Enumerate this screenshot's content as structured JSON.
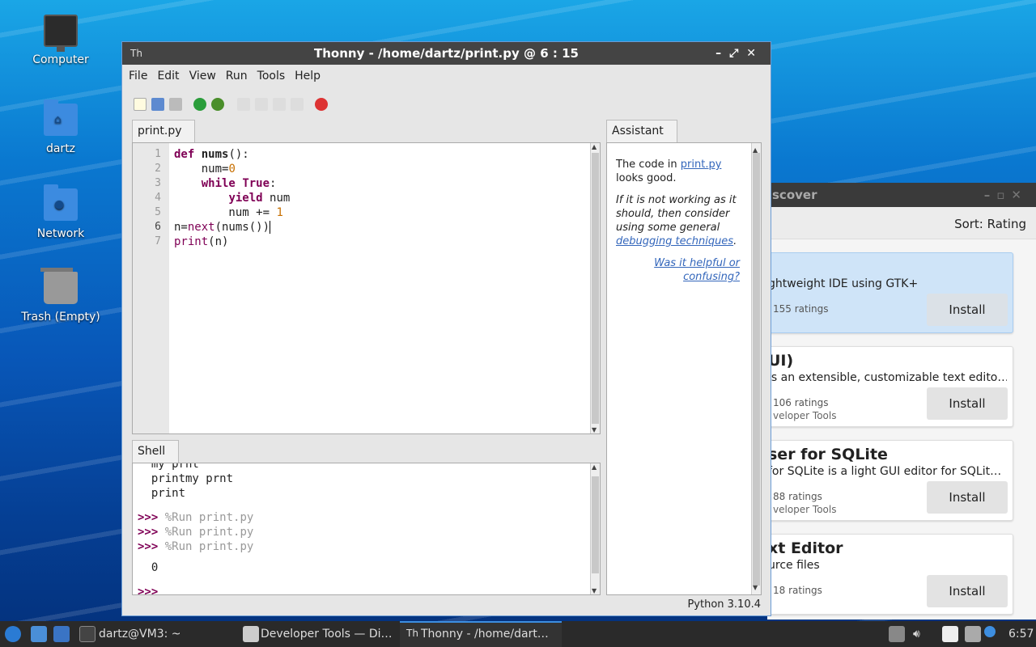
{
  "desktop": {
    "icons": [
      {
        "label": "Computer"
      },
      {
        "label": "dartz"
      },
      {
        "label": "Network"
      },
      {
        "label": "Trash (Empty)"
      }
    ]
  },
  "discover": {
    "title": "scover",
    "sort_label": "Sort: Rating",
    "cards": [
      {
        "title": "",
        "desc": "ghtweight IDE using GTK+",
        "ratings": "155 ratings",
        "category": "",
        "install": "Install"
      },
      {
        "title": "UI)",
        "desc": "is an extensible, customizable text edito…",
        "ratings": "106 ratings",
        "category": "veloper Tools",
        "install": "Install"
      },
      {
        "title": "ser for SQLite",
        "desc": "for SQLite is a light GUI editor for SQLit…",
        "ratings": "88 ratings",
        "category": "veloper Tools",
        "install": "Install"
      },
      {
        "title": "xt Editor",
        "desc": "urce files",
        "ratings": "18 ratings",
        "category": "",
        "install": "Install"
      }
    ]
  },
  "thonny": {
    "title": "Thonny  -  /home/dartz/print.py  @  6 : 15",
    "logo": "Th",
    "menu": [
      "File",
      "Edit",
      "View",
      "Run",
      "Tools",
      "Help"
    ],
    "editor_tab": "print.py",
    "shell_tab": "Shell",
    "assistant_tab": "Assistant",
    "line_numbers": [
      "1",
      "2",
      "3",
      "4",
      "5",
      "6",
      "7"
    ],
    "shell": {
      "line1": "my prnt",
      "line2": "printmy prnt",
      "line3": "print",
      "prompt": ">>>",
      "cmd": "%Run print.py",
      "output": "0"
    },
    "assistant": {
      "p1a": "The code in ",
      "p1link": "print.py",
      "p1b": " looks good.",
      "p2a": "If it is not working as it should, then consider using some general ",
      "p2link": "debugging techniques",
      "p2b": ".",
      "feedback": "Was it helpful or confusing?"
    },
    "status": "Python 3.10.4"
  },
  "taskbar": {
    "terminal": "dartz@VM3: ~",
    "discover": "Developer Tools — Di…",
    "thonny": "Thonny  -  /home/dart…",
    "clock": "6:57"
  }
}
